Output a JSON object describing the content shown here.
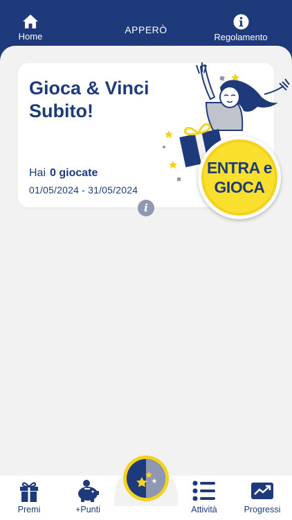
{
  "header": {
    "home_label": "Home",
    "title": "APPERÒ",
    "rules_label": "Regolamento"
  },
  "card": {
    "title_line1": "Gioca & Vinci",
    "title_line2": "Subito!",
    "have_prefix": "Hai",
    "plays_count": "0 giocate",
    "date_range": "01/05/2024 - 31/05/2024"
  },
  "cta": {
    "line1": "ENTRA e",
    "line2": "GIOCA"
  },
  "tabs": [
    {
      "label": "Premi",
      "icon": "gift-icon"
    },
    {
      "label": "+Punti",
      "icon": "piggy-bank-icon"
    },
    {
      "label": "Attività",
      "icon": "list-icon"
    },
    {
      "label": "Progressi",
      "icon": "trend-chart-icon"
    }
  ],
  "colors": {
    "primary": "#1e3a7b",
    "accent_yellow": "#f5d21f",
    "background": "#f2f2f2"
  }
}
